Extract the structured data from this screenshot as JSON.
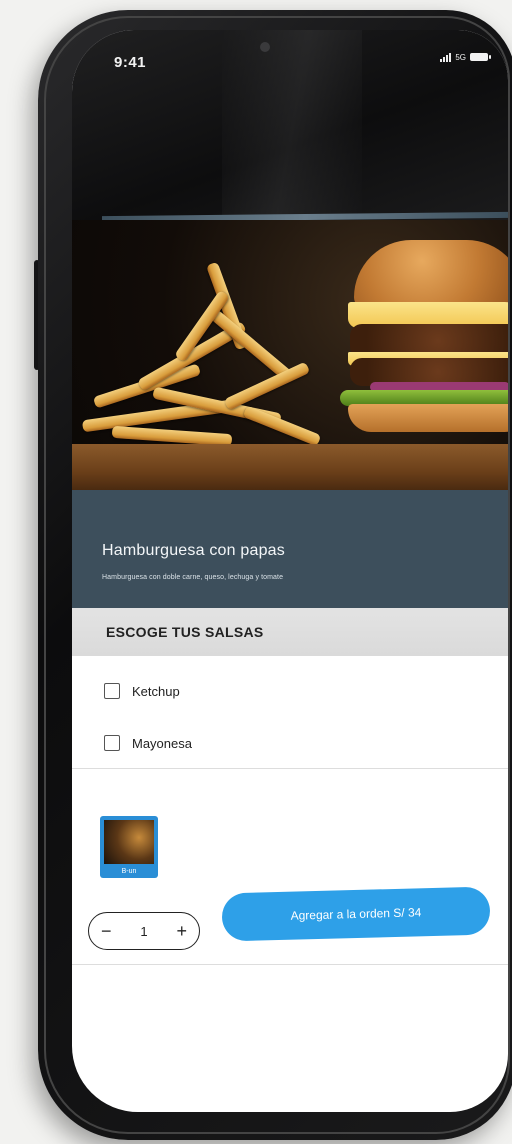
{
  "status_bar": {
    "time": "9:41",
    "network": "5G"
  },
  "product": {
    "title": "Hamburguesa con papas",
    "description": "Hamburguesa con doble carne, queso, lechuga y tomate"
  },
  "sauces_section": {
    "title": "ESCOGE TUS SALSAS",
    "options": [
      {
        "label": "Ketchup",
        "checked": false
      },
      {
        "label": "Mayonesa",
        "checked": false
      }
    ]
  },
  "thumbnail": {
    "label": "B-un"
  },
  "order": {
    "quantity": "1",
    "decrement_label": "−",
    "increment_label": "+",
    "add_button_label": "Agregar a la orden S/ 34"
  },
  "colors": {
    "accent": "#2ea0e8",
    "title_band": "#3d4f5c",
    "section_header": "#dcdcdc"
  },
  "icons": {
    "signal": "signal-icon",
    "battery": "battery-icon",
    "checkbox": "checkbox-icon"
  }
}
